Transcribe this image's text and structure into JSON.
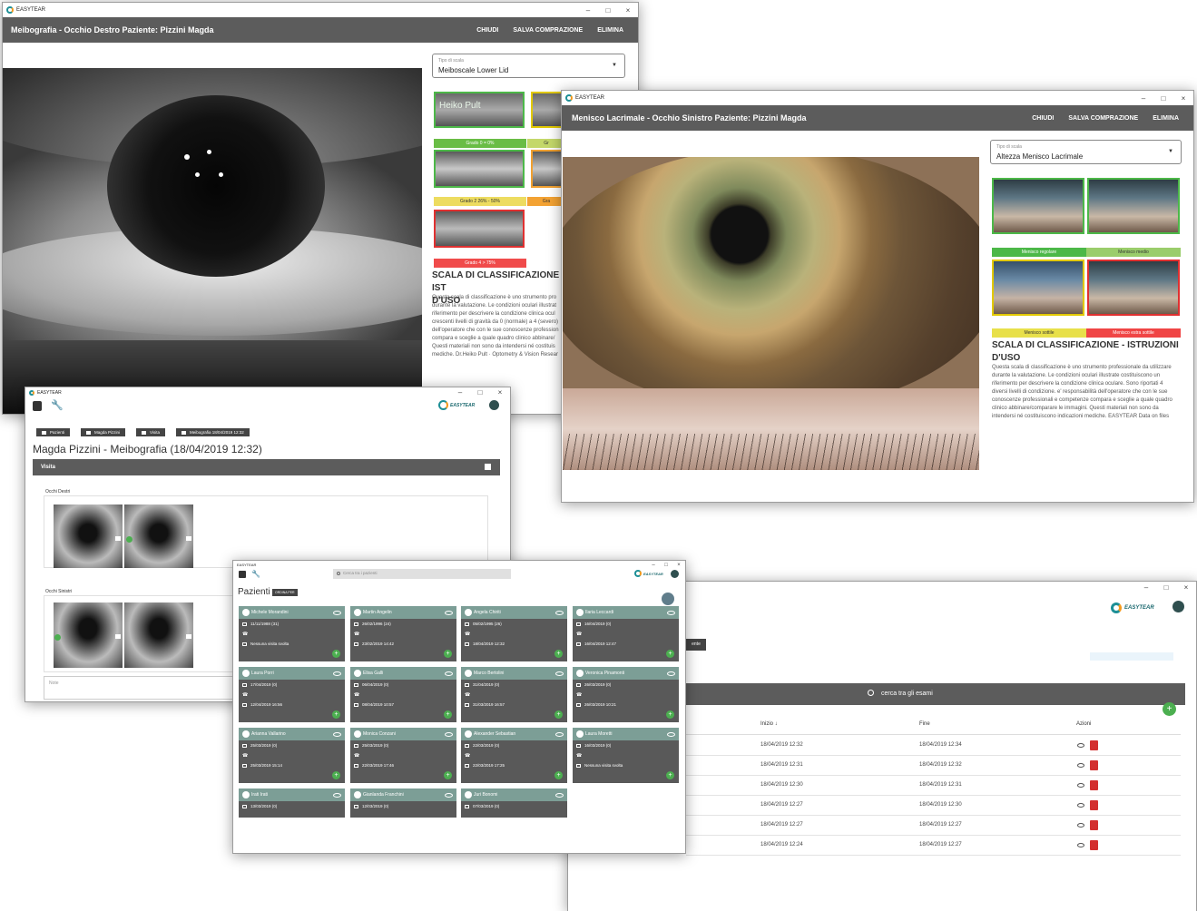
{
  "meibo": {
    "titlebar": "EASYTEAR",
    "title": "Meibografia - Occhio Destro Paziente: Pizzini Magda",
    "actions": [
      "CHIUDI",
      "SALVA COMPRAZIONE",
      "ELIMINA"
    ],
    "scale_label": "Tipo di scala",
    "scale_value": "Meiboscale Lower Lid",
    "overlay": "Heiko Pult",
    "grades": [
      "Grado 0 = 0%",
      "Gr",
      "Grado 2 26% - 50%",
      "Gra",
      "Grado 4 > 75%"
    ],
    "heading_line1": "SCALA DI CLASSIFICAZIONE - IST",
    "heading_line2": "D'USO",
    "instructions": [
      "Questa scala di classificazione è uno strumento pro",
      "durante la valutazione. Le condizioni oculari illustrat",
      "riferimento per descrivere la condizione clinica ocul",
      "crescenti livelli di gravità da 0 (normale) a 4 (severo)",
      "dell'operatore che con le sue conoscenze profession",
      "compara e sceglie a quale quadro clinico abbinare/",
      "Questi materiali non sono da intendersi né costituis",
      "mediche. Dr.Heiko Pult · Optometry & Vision Resear"
    ]
  },
  "menisco": {
    "titlebar": "EASYTEAR",
    "title": "Menisco Lacrimale - Occhio Sinistro Paziente: Pizzini Magda",
    "actions": [
      "CHIUDI",
      "SALVA COMPRAZIONE",
      "ELIMINA"
    ],
    "scale_label": "Tipo di scala",
    "scale_value": "Altezza Menisco Lacrimale",
    "bands": [
      "Menisco regolare",
      "Menisco medio",
      "Menisco sottile",
      "Menisco estra sottile"
    ],
    "heading_line1": "SCALA DI CLASSIFICAZIONE - ISTRUZIONI",
    "heading_line2": "D'USO",
    "instructions": [
      "Questa scala di classificazione è uno strumento professionale da utilizzare",
      "durante la valutazione. Le condizioni oculari illustrate costituiscono un",
      "riferimento per descrivere la condizione clinica oculare. Sono riportati 4",
      "diversi livelli di condizione. e' responsabilità dell'operatore che con le sue",
      "conoscenze professionali e competenze compara e sceglie a quale quadro",
      "clinico abbinare/comparare le immagini. Questi materiali non sono da",
      "intendersi né costituiscono indicazioni mediche. EASYTEAR Data on files"
    ]
  },
  "visit": {
    "titlebar": "EASYTEAR",
    "crumbs": [
      "Pazienti",
      "Magda Pizzini",
      "Visita",
      "Meibografia 18/04/2019 12:32"
    ],
    "title": "Magda Pizzini - Meibografia (18/04/2019 12:32)",
    "panel": "Visita",
    "right_eyes": "Occhi Destri",
    "left_eyes": "Occhi Sinistri",
    "notes_placeholder": "Note"
  },
  "exams": {
    "btn_partial": "ente",
    "search_placeholder": "cerca tra gli esami",
    "columns": [
      "Inizio ↓",
      "Fine",
      "Azioni"
    ],
    "rows": [
      [
        "18/04/2019 12:32",
        "18/04/2019 12:34"
      ],
      [
        "18/04/2019 12:31",
        "18/04/2019 12:32"
      ],
      [
        "18/04/2019 12:30",
        "18/04/2019 12:31"
      ],
      [
        "18/04/2019 12:27",
        "18/04/2019 12:30"
      ],
      [
        "18/04/2019 12:27",
        "18/04/2019 12:27"
      ],
      [
        "18/04/2019 12:24",
        "18/04/2019 12:27"
      ]
    ]
  },
  "patients": {
    "titlebar": "EASYTEAR",
    "search_placeholder": "Cerca tra i pazienti",
    "title": "Pazienti",
    "badge": "ORDINA PER",
    "cards": [
      {
        "name": "Michele Morandini",
        "d1": "11/11/1988 (31)",
        "d3": "Nessuna visita svolta"
      },
      {
        "name": "Martin Angelin",
        "d1": "26/02/1996 (24)",
        "d3": "23/02/2019 14:42"
      },
      {
        "name": "Angela Chiriti",
        "d1": "05/02/1995 (26)",
        "d3": "18/04/2019 12:32"
      },
      {
        "name": "Ilaria Leccardi",
        "d1": "16/04/2019 (0)",
        "d3": "16/04/2019 12:47"
      },
      {
        "name": "Laura Porri",
        "d1": "17/04/2019 (0)",
        "d3": "12/04/2019 16:56"
      },
      {
        "name": "Elisa Galli",
        "d1": "06/04/2019 (0)",
        "d3": "08/04/2019 10:57"
      },
      {
        "name": "Marco Bertolini",
        "d1": "31/04/2019 (0)",
        "d3": "31/03/2019 16:57"
      },
      {
        "name": "Veronica Pinamonti",
        "d1": "26/03/2019 (0)",
        "d3": "26/03/2019 10:21"
      },
      {
        "name": "Arianna Vallarino",
        "d1": "25/03/2019 (0)",
        "d3": "25/03/2019 15:14"
      },
      {
        "name": "Monica Conzani",
        "d1": "25/03/2019 (0)",
        "d3": "22/03/2019 17:46"
      },
      {
        "name": "Alexander Sebastian",
        "d1": "22/03/2019 (0)",
        "d3": "22/03/2019 17:25"
      },
      {
        "name": "Laura Moretti",
        "d1": "16/03/2019 (0)",
        "d3": "Nessuna visita svolta"
      },
      {
        "name": "Irati Irati",
        "d1": "13/03/2019 (0)"
      },
      {
        "name": "Gianlanda Franchini",
        "d1": "12/03/2019 (0)"
      },
      {
        "name": "Juri Bonomi",
        "d1": "07/03/2019 (0)"
      }
    ]
  }
}
